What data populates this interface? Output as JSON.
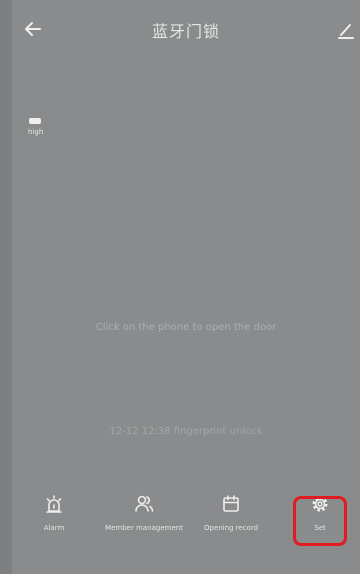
{
  "header": {
    "title": "蓝牙门锁"
  },
  "battery": {
    "label": "high"
  },
  "main": {
    "open_hint": "Click on the phone to open the door",
    "last_record": "12-12 12:38  fingerprint unlock"
  },
  "bottom_nav": {
    "items": [
      {
        "label": "Alarm",
        "icon": "alarm-icon"
      },
      {
        "label": "Member management",
        "icon": "members-icon"
      },
      {
        "label": "Opening record",
        "icon": "calendar-icon"
      },
      {
        "label": "Set",
        "icon": "gear-icon"
      }
    ]
  },
  "colors": {
    "background": "#898b8c",
    "highlight": "#e01b22"
  }
}
